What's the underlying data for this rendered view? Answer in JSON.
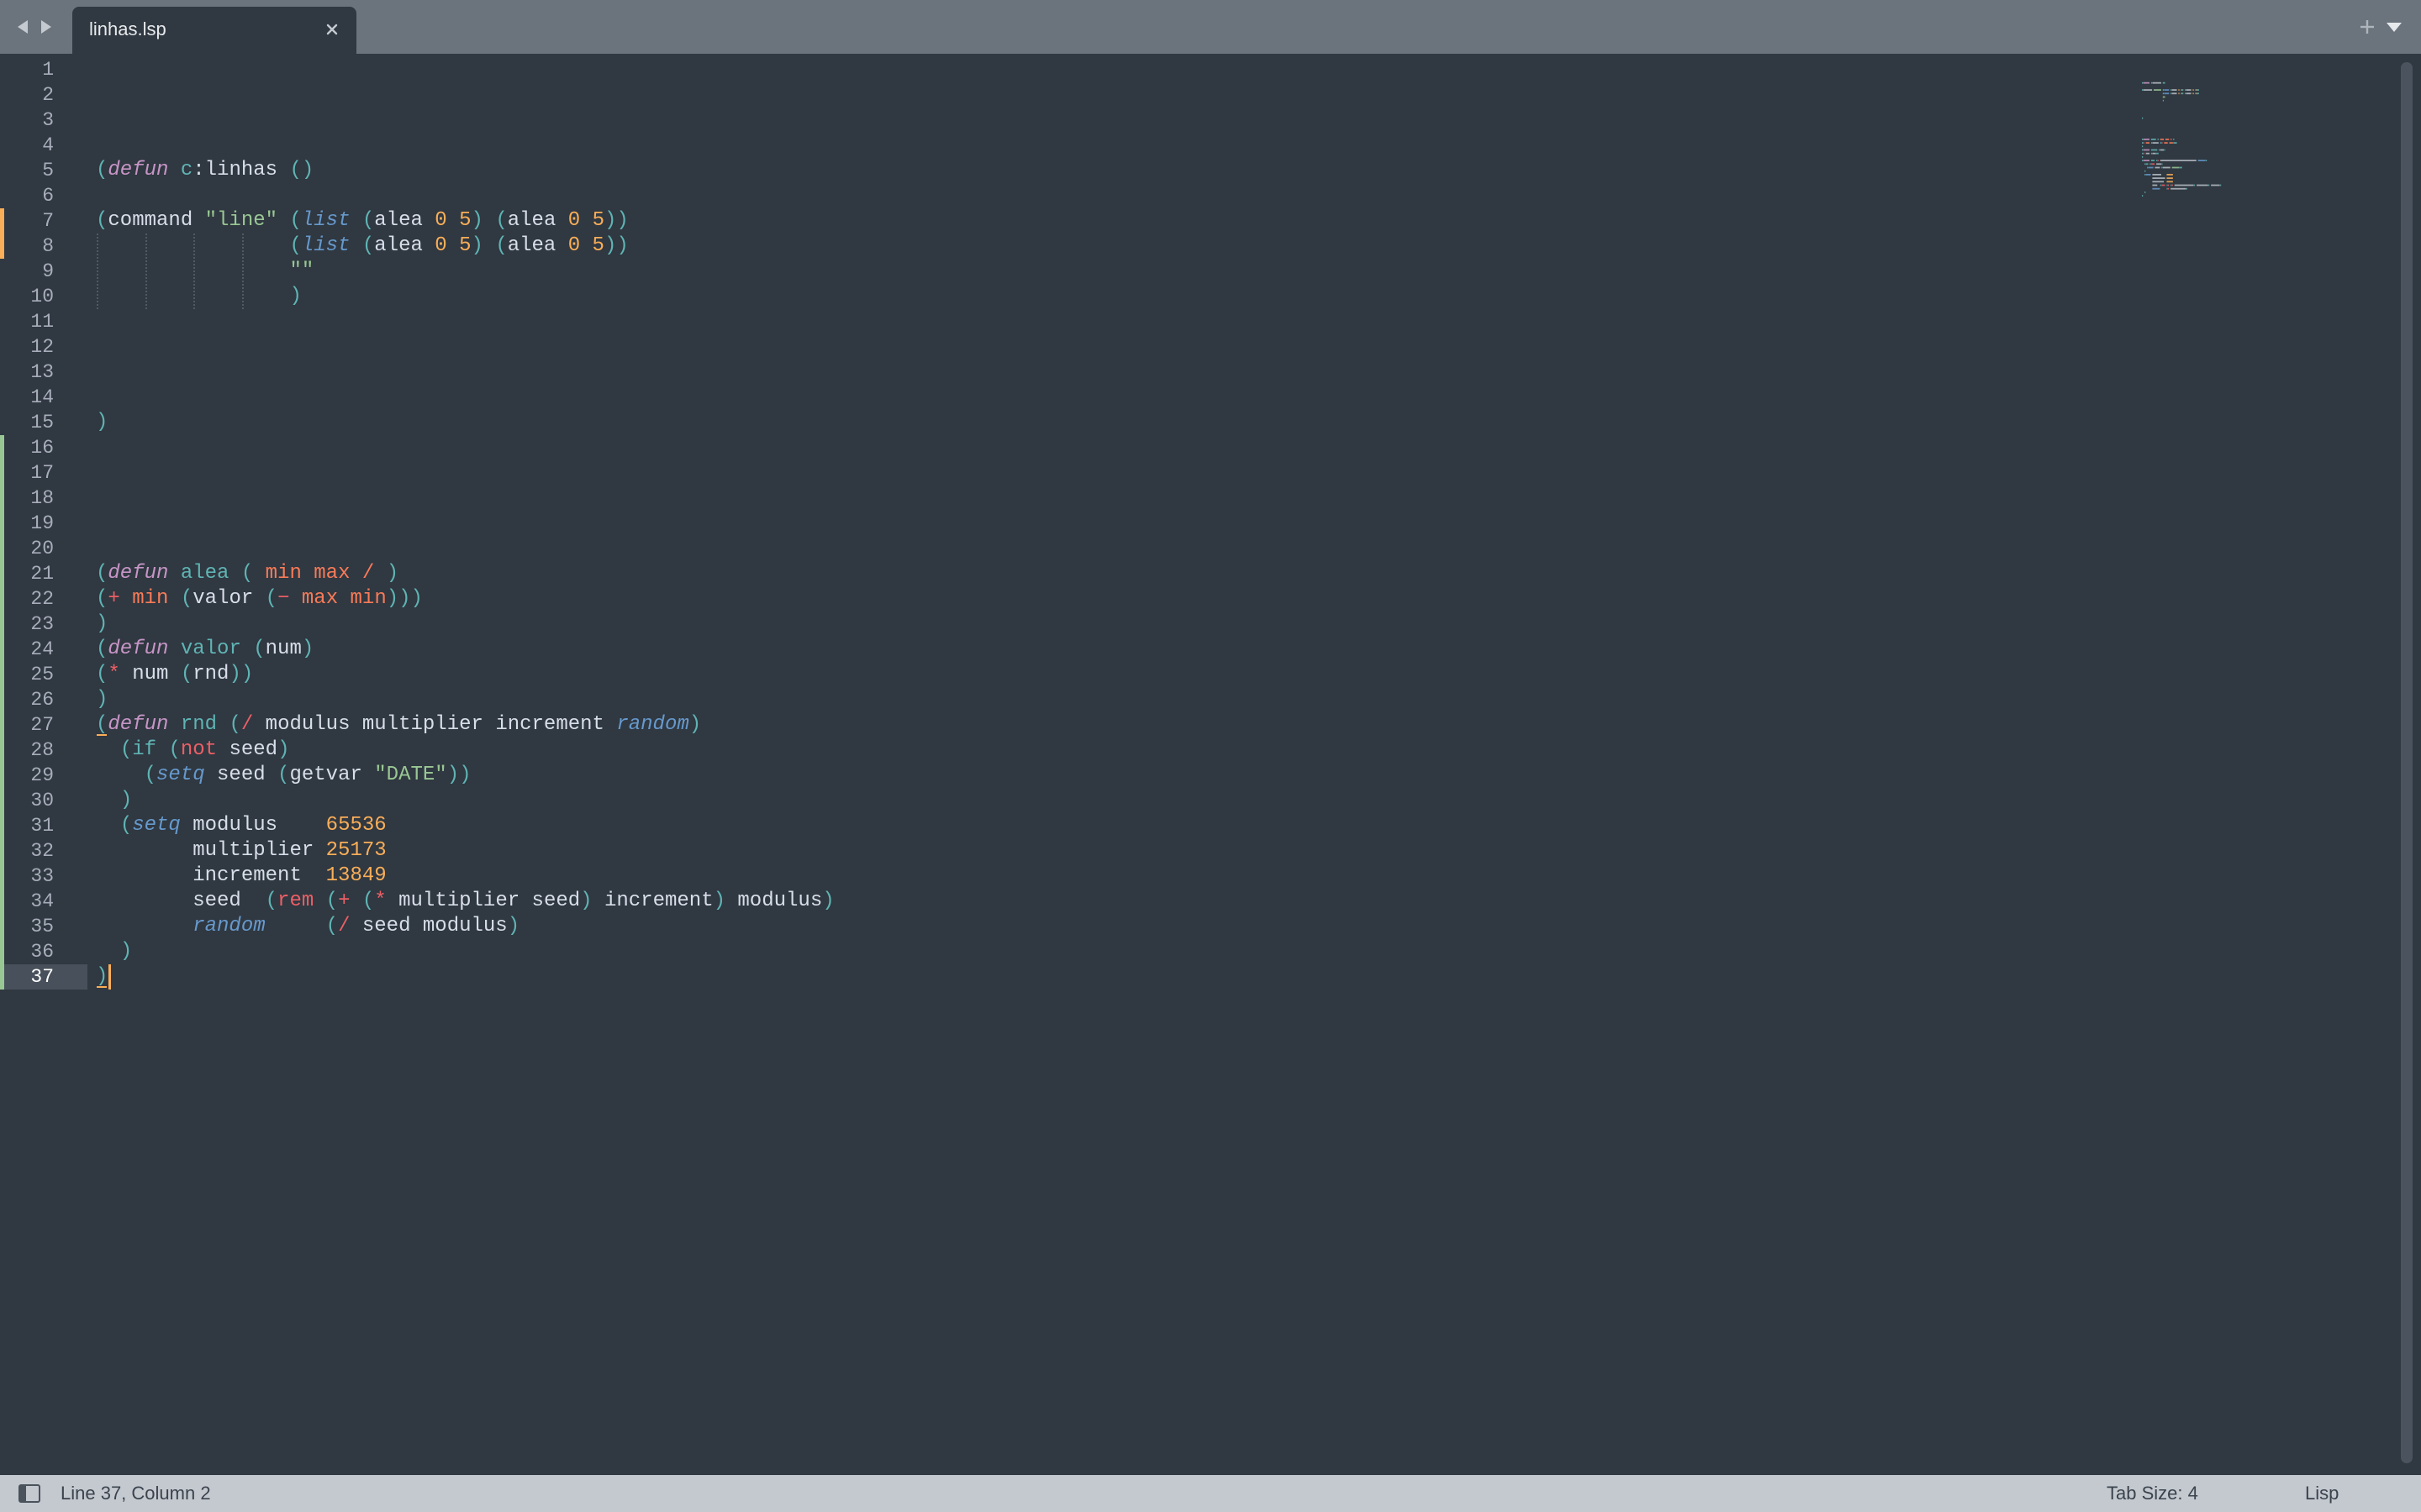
{
  "tabs": [
    {
      "label": "linhas.lsp",
      "active": true
    }
  ],
  "editor": {
    "current_line": 37,
    "line_count": 37,
    "lines": [
      [],
      [],
      [],
      [],
      [
        [
          "(",
          "paren"
        ],
        [
          "defun",
          "kw"
        ],
        [
          " ",
          "id"
        ],
        [
          "c",
          "fn"
        ],
        [
          ":linhas ",
          "id"
        ],
        [
          "()",
          "paren"
        ]
      ],
      [],
      [
        [
          "(",
          "paren"
        ],
        [
          "command ",
          "id"
        ],
        [
          "\"line\"",
          "str"
        ],
        [
          " ",
          "id"
        ],
        [
          "(",
          "paren"
        ],
        [
          "list",
          "builtin"
        ],
        [
          " ",
          "id"
        ],
        [
          "(",
          "paren"
        ],
        [
          "alea ",
          "id"
        ],
        [
          "0",
          "num"
        ],
        [
          " ",
          "id"
        ],
        [
          "5",
          "num"
        ],
        [
          ")",
          "paren"
        ],
        [
          " ",
          "id"
        ],
        [
          "(",
          "paren"
        ],
        [
          "alea ",
          "id"
        ],
        [
          "0",
          "num"
        ],
        [
          " ",
          "id"
        ],
        [
          "5",
          "num"
        ],
        [
          "))",
          "paren"
        ]
      ],
      [
        [
          "                ",
          "id"
        ],
        [
          "(",
          "paren"
        ],
        [
          "list",
          "builtin"
        ],
        [
          " ",
          "id"
        ],
        [
          "(",
          "paren"
        ],
        [
          "alea ",
          "id"
        ],
        [
          "0",
          "num"
        ],
        [
          " ",
          "id"
        ],
        [
          "5",
          "num"
        ],
        [
          ")",
          "paren"
        ],
        [
          " ",
          "id"
        ],
        [
          "(",
          "paren"
        ],
        [
          "alea ",
          "id"
        ],
        [
          "0",
          "num"
        ],
        [
          " ",
          "id"
        ],
        [
          "5",
          "num"
        ],
        [
          "))",
          "paren"
        ]
      ],
      [
        [
          "                ",
          "id"
        ],
        [
          "\"\"",
          "str"
        ]
      ],
      [
        [
          "                ",
          "id"
        ],
        [
          ")",
          "paren"
        ]
      ],
      [],
      [],
      [],
      [],
      [
        [
          ")",
          "paren"
        ]
      ],
      [],
      [],
      [],
      [],
      [],
      [
        [
          "(",
          "paren"
        ],
        [
          "defun",
          "kw"
        ],
        [
          " ",
          "id"
        ],
        [
          "alea",
          "fn"
        ],
        [
          " ",
          "id"
        ],
        [
          "(",
          "paren"
        ],
        [
          " ",
          "id"
        ],
        [
          "min",
          "param"
        ],
        [
          " ",
          "id"
        ],
        [
          "max",
          "param"
        ],
        [
          " ",
          "id"
        ],
        [
          "/",
          "param"
        ],
        [
          " ",
          "id"
        ],
        [
          ")",
          "paren"
        ]
      ],
      [
        [
          "(",
          "paren"
        ],
        [
          "+",
          "op"
        ],
        [
          " ",
          "id"
        ],
        [
          "min",
          "param"
        ],
        [
          " ",
          "id"
        ],
        [
          "(",
          "paren"
        ],
        [
          "valor ",
          "id"
        ],
        [
          "(",
          "paren"
        ],
        [
          "−",
          "op"
        ],
        [
          " ",
          "id"
        ],
        [
          "max",
          "param"
        ],
        [
          " ",
          "id"
        ],
        [
          "min",
          "param"
        ],
        [
          ")))",
          "paren"
        ]
      ],
      [
        [
          ")",
          "paren"
        ]
      ],
      [
        [
          "(",
          "paren"
        ],
        [
          "defun",
          "kw"
        ],
        [
          " ",
          "id"
        ],
        [
          "valor",
          "fn"
        ],
        [
          " ",
          "id"
        ],
        [
          "(",
          "paren"
        ],
        [
          "num",
          "id"
        ],
        [
          ")",
          "paren"
        ]
      ],
      [
        [
          "(",
          "paren"
        ],
        [
          "*",
          "op"
        ],
        [
          " ",
          "id"
        ],
        [
          "num ",
          "id"
        ],
        [
          "(",
          "paren"
        ],
        [
          "rnd",
          "id"
        ],
        [
          "))",
          "paren"
        ]
      ],
      [
        [
          ")",
          "paren"
        ]
      ],
      [
        [
          "(",
          "paren"
        ],
        [
          "defun",
          "kw"
        ],
        [
          " ",
          "id"
        ],
        [
          "rnd",
          "fn"
        ],
        [
          " ",
          "id"
        ],
        [
          "(",
          "paren"
        ],
        [
          "/",
          "op"
        ],
        [
          " ",
          "id"
        ],
        [
          "modulus multiplier increment ",
          "id"
        ],
        [
          "random",
          "builtin"
        ],
        [
          ")",
          "paren"
        ]
      ],
      [
        [
          "  ",
          "id"
        ],
        [
          "(",
          "paren"
        ],
        [
          "if",
          "fn"
        ],
        [
          " ",
          "id"
        ],
        [
          "(",
          "paren"
        ],
        [
          "not",
          "op"
        ],
        [
          " ",
          "id"
        ],
        [
          "seed",
          "id"
        ],
        [
          ")",
          "paren"
        ]
      ],
      [
        [
          "    ",
          "id"
        ],
        [
          "(",
          "paren"
        ],
        [
          "setq",
          "builtin"
        ],
        [
          " ",
          "id"
        ],
        [
          "seed ",
          "id"
        ],
        [
          "(",
          "paren"
        ],
        [
          "getvar ",
          "id"
        ],
        [
          "\"DATE\"",
          "str"
        ],
        [
          "))",
          "paren"
        ]
      ],
      [
        [
          "  ",
          "id"
        ],
        [
          ")",
          "paren"
        ]
      ],
      [
        [
          "  ",
          "id"
        ],
        [
          "(",
          "paren"
        ],
        [
          "setq",
          "builtin"
        ],
        [
          " ",
          "id"
        ],
        [
          "modulus    ",
          "id"
        ],
        [
          "65536",
          "num"
        ]
      ],
      [
        [
          "        ",
          "id"
        ],
        [
          "multiplier ",
          "id"
        ],
        [
          "25173",
          "num"
        ]
      ],
      [
        [
          "        ",
          "id"
        ],
        [
          "increment  ",
          "id"
        ],
        [
          "13849",
          "num"
        ]
      ],
      [
        [
          "        ",
          "id"
        ],
        [
          "seed  ",
          "id"
        ],
        [
          "(",
          "paren"
        ],
        [
          "rem",
          "op"
        ],
        [
          " ",
          "id"
        ],
        [
          "(",
          "paren"
        ],
        [
          "+",
          "op"
        ],
        [
          " ",
          "id"
        ],
        [
          "(",
          "paren"
        ],
        [
          "*",
          "op"
        ],
        [
          " ",
          "id"
        ],
        [
          "multiplier seed",
          "id"
        ],
        [
          ")",
          "paren"
        ],
        [
          " ",
          "id"
        ],
        [
          "increment",
          "id"
        ],
        [
          ")",
          "paren"
        ],
        [
          " ",
          "id"
        ],
        [
          "modulus",
          "id"
        ],
        [
          ")",
          "paren"
        ]
      ],
      [
        [
          "        ",
          "id"
        ],
        [
          "random",
          "builtin"
        ],
        [
          "     ",
          "id"
        ],
        [
          "(",
          "paren"
        ],
        [
          "/",
          "op"
        ],
        [
          " ",
          "id"
        ],
        [
          "seed modulus",
          "id"
        ],
        [
          ")",
          "paren"
        ]
      ],
      [
        [
          "  ",
          "id"
        ],
        [
          ")",
          "paren"
        ]
      ],
      [
        [
          ")",
          "paren"
        ]
      ]
    ],
    "modified_lines": {
      "orange": [
        7,
        8
      ],
      "green": [
        16,
        37
      ]
    }
  },
  "status_bar": {
    "position": "Line 37, Column 2",
    "tab_size": "Tab Size: 4",
    "syntax": "Lisp"
  },
  "colors": {
    "background": "#303841",
    "tabbar": "#6b737c",
    "statusbar": "#c4c9d0",
    "cursor": "#f9ae58",
    "paren": "#5fb4b4",
    "keyword": "#c695c6",
    "string": "#99c794",
    "number": "#f9ae58",
    "operator": "#ec5f66",
    "param": "#f97b58",
    "builtin": "#6699cc",
    "modified": "#f9ae58",
    "added": "#99c794"
  },
  "icons": {
    "back": "chevron-left-icon",
    "forward": "chevron-right-icon",
    "close": "close-icon",
    "add": "plus-icon",
    "tab_list": "caret-down-icon",
    "sidebar": "sidebar-toggle-icon"
  }
}
